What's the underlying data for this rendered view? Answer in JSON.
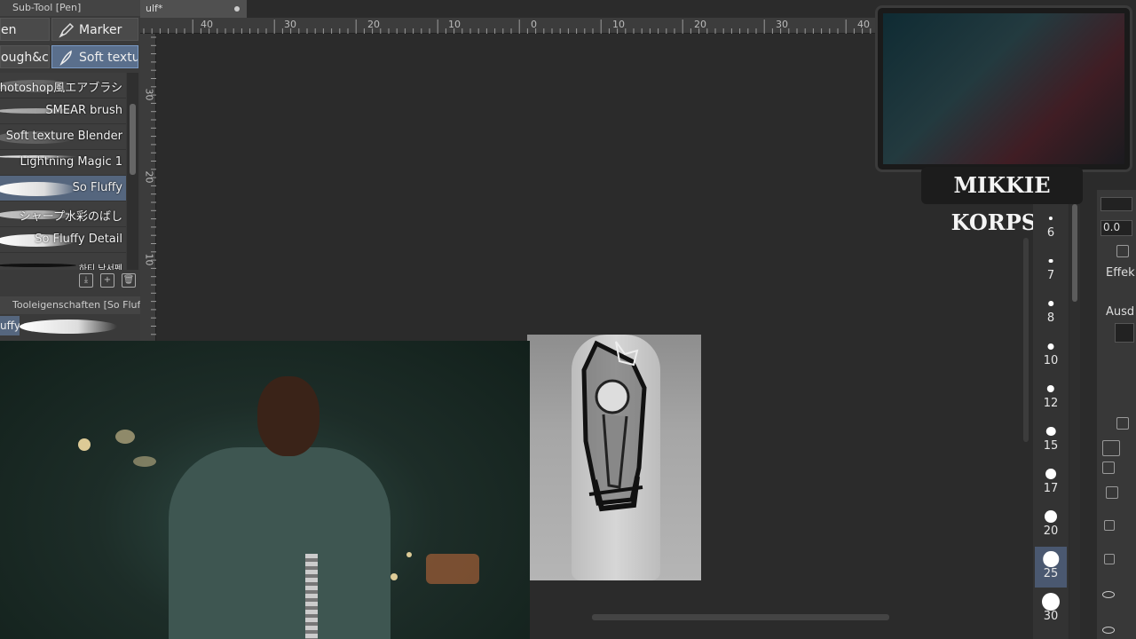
{
  "subtool": {
    "title": "Sub-Tool [Pen]",
    "top_buttons": [
      {
        "label": "en"
      },
      {
        "label": "Marker"
      },
      {
        "label": "ough&co"
      },
      {
        "label": "Soft texture"
      }
    ],
    "brushes": [
      {
        "label": "Photoshop風エアブラシ"
      },
      {
        "label": "SMEAR brush"
      },
      {
        "label": "Soft texture Blender"
      },
      {
        "label": "Lightning Magic 1"
      },
      {
        "label": "So Fluffy"
      },
      {
        "label": "シャープ水彩のばし"
      },
      {
        "label": "So Fluffy Detail"
      },
      {
        "label": "하티 낙서펜"
      }
    ],
    "selected_brush_index": 4
  },
  "tool_properties": {
    "title": "Tooleigenschaften [So Fluffy",
    "name": "uffy"
  },
  "document": {
    "tab_title": "ulf*"
  },
  "rulers": {
    "horizontal_labels": [
      "40",
      "30",
      "20",
      "10",
      "0",
      "10",
      "20",
      "30",
      "40"
    ],
    "vertical_labels": [
      "30",
      "20",
      "10"
    ]
  },
  "streamer": {
    "name": "MIKKIE KORPSE"
  },
  "brush_sizes": {
    "values": [
      "6",
      "7",
      "8",
      "10",
      "12",
      "15",
      "17",
      "20",
      "25",
      "30"
    ],
    "selected": "25"
  },
  "right_panel": {
    "value_field": "0.0",
    "label_effect": "Effek",
    "label_express": "Ausd"
  },
  "colors": {
    "panel_bg": "#3a3a3a",
    "selection": "#55667e",
    "canvas_bg": "#2b2b2b"
  }
}
